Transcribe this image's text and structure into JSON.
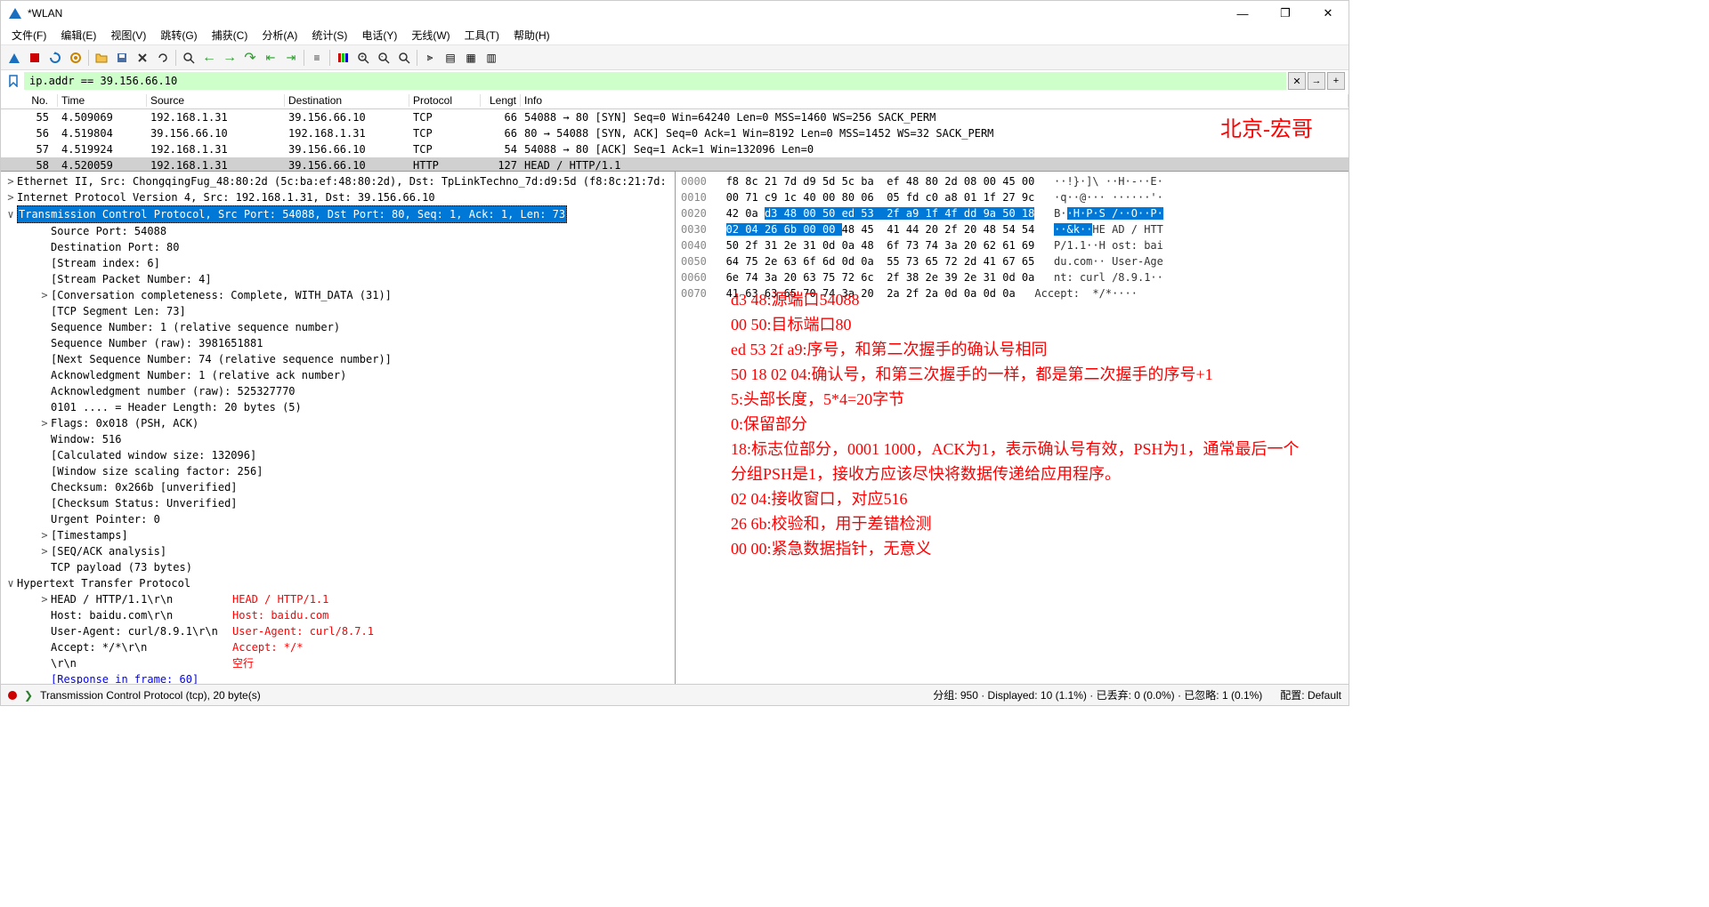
{
  "window": {
    "title": "*WLAN"
  },
  "menu": [
    "文件(F)",
    "编辑(E)",
    "视图(V)",
    "跳转(G)",
    "捕获(C)",
    "分析(A)",
    "统计(S)",
    "电话(Y)",
    "无线(W)",
    "工具(T)",
    "帮助(H)"
  ],
  "filter": {
    "value": "ip.addr == 39.156.66.10"
  },
  "filter_buttons": {
    "clear": "✕",
    "apply": "→",
    "add": "+"
  },
  "columns": {
    "no": "No.",
    "time": "Time",
    "source": "Source",
    "destination": "Destination",
    "protocol": "Protocol",
    "length": "Lengt",
    "info": "Info"
  },
  "packets": [
    {
      "no": "55",
      "time": "4.509069",
      "src": "192.168.1.31",
      "dst": "39.156.66.10",
      "proto": "TCP",
      "len": "66",
      "info": "54088 → 80 [SYN] Seq=0 Win=64240 Len=0 MSS=1460 WS=256 SACK_PERM"
    },
    {
      "no": "56",
      "time": "4.519804",
      "src": "39.156.66.10",
      "dst": "192.168.1.31",
      "proto": "TCP",
      "len": "66",
      "info": "80 → 54088 [SYN, ACK] Seq=0 Ack=1 Win=8192 Len=0 MSS=1452 WS=32 SACK_PERM"
    },
    {
      "no": "57",
      "time": "4.519924",
      "src": "192.168.1.31",
      "dst": "39.156.66.10",
      "proto": "TCP",
      "len": "54",
      "info": "54088 → 80 [ACK] Seq=1 Ack=1 Win=132096 Len=0"
    },
    {
      "no": "58",
      "time": "4.520059",
      "src": "192.168.1.31",
      "dst": "39.156.66.10",
      "proto": "HTTP",
      "len": "127",
      "info": "HEAD / HTTP/1.1"
    }
  ],
  "annotation_tr": "北京-宏哥",
  "details": {
    "eth": "Ethernet II, Src: ChongqingFug_48:80:2d (5c:ba:ef:48:80:2d), Dst: TpLinkTechno_7d:d9:5d (f8:8c:21:7d:",
    "ip": "Internet Protocol Version 4, Src: 192.168.1.31, Dst: 39.156.66.10",
    "tcp": "Transmission Control Protocol, Src Port: 54088, Dst Port: 80, Seq: 1, Ack: 1, Len: 73",
    "tcp_fields": [
      "Source Port: 54088",
      "Destination Port: 80",
      "[Stream index: 6]",
      "[Stream Packet Number: 4]",
      "[Conversation completeness: Complete, WITH_DATA (31)]",
      "[TCP Segment Len: 73]",
      "Sequence Number: 1    (relative sequence number)",
      "Sequence Number (raw): 3981651881",
      "[Next Sequence Number: 74    (relative sequence number)]",
      "Acknowledgment Number: 1    (relative ack number)",
      "Acknowledgment number (raw): 525327770",
      "0101 .... = Header Length: 20 bytes (5)",
      "Flags: 0x018 (PSH, ACK)",
      "Window: 516",
      "[Calculated window size: 132096]",
      "[Window size scaling factor: 256]",
      "Checksum: 0x266b [unverified]",
      "[Checksum Status: Unverified]",
      "Urgent Pointer: 0",
      "[Timestamps]",
      "[SEQ/ACK analysis]",
      "TCP payload (73 bytes)"
    ],
    "tcp_expand": {
      "4": ">",
      "12": ">",
      "19": ">",
      "20": ">"
    },
    "http": "Hypertext Transfer Protocol",
    "http_fields": [
      "HEAD / HTTP/1.1\\r\\n",
      "Host: baidu.com\\r\\n",
      "User-Agent: curl/8.9.1\\r\\n",
      "Accept: */*\\r\\n",
      "\\r\\n",
      "[Response in frame: 60]"
    ],
    "http_anno": [
      "HEAD / HTTP/1.1",
      "Host: baidu.com",
      "User-Agent: curl/8.7.1",
      "Accept: */*",
      "空行"
    ]
  },
  "hex": [
    {
      "off": "0000",
      "b": "f8 8c 21 7d d9 5d 5c ba  ef 48 80 2d 08 00 45 00",
      "a": "··!}·]\\ ··H·-··E·"
    },
    {
      "off": "0010",
      "b": "00 71 c9 1c 40 00 80 06  05 fd c0 a8 01 1f 27 9c",
      "a": "·q··@··· ······'·"
    },
    {
      "off": "0020",
      "bp": "42 0a ",
      "bs": "d3 48 00 50 ed 53  2f a9 1f 4f dd 9a 50 18",
      "ap": "B·",
      "as": "·H·P·S /··O··P·"
    },
    {
      "off": "0030",
      "bs": "02 04 26 6b 00 00 ",
      "bp": "48 45  41 44 20 2f 20 48 54 54",
      "as": "··&k··",
      "ap": "HE AD / HTT"
    },
    {
      "off": "0040",
      "b": "50 2f 31 2e 31 0d 0a 48  6f 73 74 3a 20 62 61 69",
      "a": "P/1.1··H ost: bai"
    },
    {
      "off": "0050",
      "b": "64 75 2e 63 6f 6d 0d 0a  55 73 65 72 2d 41 67 65",
      "a": "du.com·· User-Age"
    },
    {
      "off": "0060",
      "b": "6e 74 3a 20 63 75 72 6c  2f 38 2e 39 2e 31 0d 0a",
      "a": "nt: curl /8.9.1··"
    },
    {
      "off": "0070",
      "b": "41 63 63 65 70 74 3a 20  2a 2f 2a 0d 0a 0d 0a",
      "a": "Accept:  */*····"
    }
  ],
  "big_anno": [
    "d3 48:源端口54088",
    "00 50:目标端口80",
    "ed 53 2f a9:序号，和第二次握手的确认号相同",
    "50 18 02 04:确认号，和第三次握手的一样，都是第二次握手的序号+1",
    "5:头部长度，5*4=20字节",
    "0:保留部分",
    "18:标志位部分，0001 1000，ACK为1，表示确认号有效，PSH为1，通常最后一个",
    "分组PSH是1，接收方应该尽快将数据传递给应用程序。",
    "02 04:接收窗口，对应516",
    "26 6b:校验和，用于差错检测",
    "00 00:紧急数据指针，无意义"
  ],
  "status": {
    "left": "Transmission Control Protocol (tcp), 20 byte(s)",
    "right1": "分组: 950 · Displayed: 10 (1.1%) · 已丢弃: 0 (0.0%) · 已忽略: 1 (0.1%)",
    "right2": "配置: Default"
  }
}
